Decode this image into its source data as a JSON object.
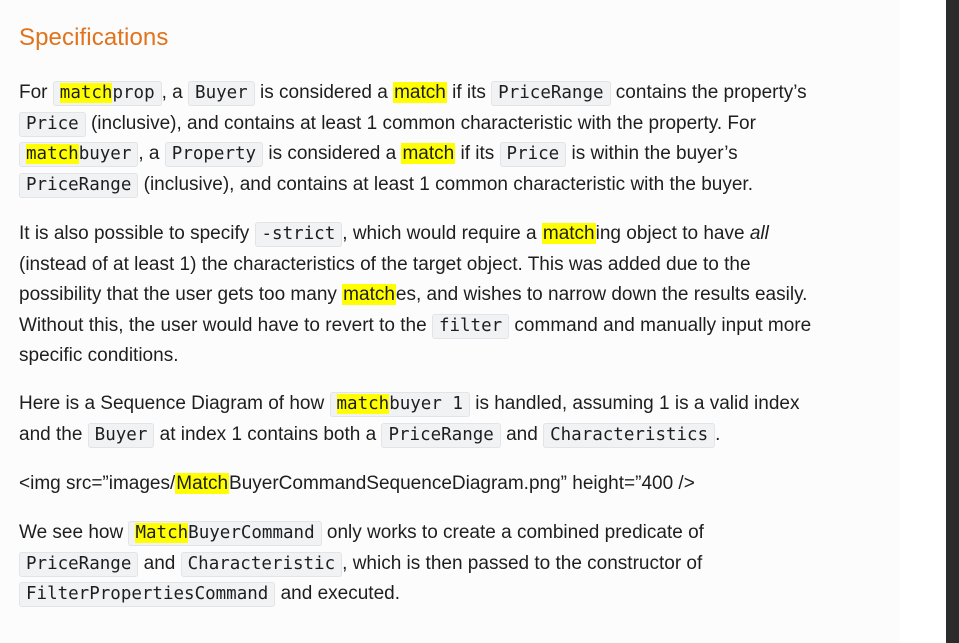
{
  "heading": "Specifications",
  "p1": {
    "l1": {
      "a": "For ",
      "code1_hl": "match",
      "code1_rest": "prop",
      "b": ", a ",
      "code2": "Buyer",
      "c": " is considered a ",
      "hl": "match",
      "d": " if its ",
      "code3": "PriceRange",
      "e": " contains the property’s"
    },
    "l2": {
      "code1": "Price",
      "a": " (inclusive), and contains at least 1 common characteristic with the property. For"
    },
    "l3": {
      "code1_hl": "match",
      "code1_rest": "buyer",
      "a": ", a ",
      "code2": "Property",
      "b": " is considered a ",
      "hl": "match",
      "c": " if its ",
      "code3": "Price",
      "d": " is within the buyer’s"
    },
    "l4": {
      "code1": "PriceRange",
      "a": " (inclusive), and contains at least 1 common characteristic with the buyer."
    }
  },
  "p2": {
    "l1": {
      "a": "It is also possible to specify ",
      "code1": "-strict",
      "b": ", which would require a ",
      "hl": "match",
      "c": "ing object to have ",
      "em": "all"
    },
    "l2": "(instead of at least 1) the characteristics of the target object. This was added due to the",
    "l3": {
      "a": "possibility that the user gets too many ",
      "hl": "match",
      "b": "es, and wishes to narrow down the results easily."
    },
    "l4": {
      "a": "Without this, the user would have to revert to the ",
      "code1": "filter",
      "b": " command and manually input more"
    },
    "l5": "specific conditions."
  },
  "p3": {
    "l1": {
      "a": "Here is a Sequence Diagram of how ",
      "code1_hl": "match",
      "code1_rest": "buyer 1",
      "b": " is handled, assuming 1 is a valid index"
    },
    "l2": {
      "a": "and the ",
      "code1": "Buyer",
      "b": " at index 1 contains both a ",
      "code2": "PriceRange",
      "c": " and ",
      "code3": "Characteristics",
      "d": "."
    }
  },
  "p4": {
    "a": "<img src=”images/",
    "hl": "Match",
    "b": "BuyerCommandSequenceDiagram.png” height=”400 />"
  },
  "p5": {
    "l1": {
      "a": "We see how ",
      "code1_hl": "Match",
      "code1_rest": "BuyerCommand",
      "b": " only works to create a combined predicate of"
    },
    "l2": {
      "code1": "PriceRange",
      "a": " and ",
      "code2": "Characteristic",
      "b": ", which is then passed to the constructor of"
    },
    "l3": {
      "code1": "FilterPropertiesCommand",
      "a": " and executed."
    }
  }
}
